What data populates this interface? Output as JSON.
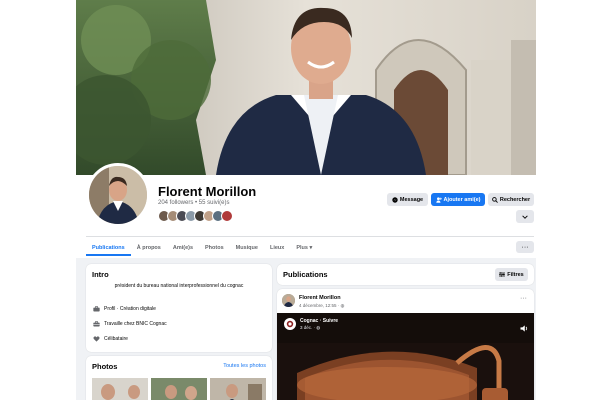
{
  "profile": {
    "name": "Florent Morillon",
    "stats": "204 followers • 55 suivi(e)s",
    "friend_colors": [
      "#6d5a4c",
      "#a58c77",
      "#4b4b54",
      "#8b9aa8",
      "#3f3a35",
      "#c0a088",
      "#5b6f80",
      "#b03a3a"
    ]
  },
  "actions": {
    "message": "Message",
    "add_friend": "Ajouter ami(e)",
    "search": "Rechercher"
  },
  "tabs": [
    {
      "label": "Publications",
      "active": true
    },
    {
      "label": "À propos",
      "active": false
    },
    {
      "label": "Ami(e)s",
      "active": false
    },
    {
      "label": "Photos",
      "active": false
    },
    {
      "label": "Musique",
      "active": false
    },
    {
      "label": "Lieux",
      "active": false
    },
    {
      "label": "Plus ▾",
      "active": false
    }
  ],
  "intro": {
    "title": "Intro",
    "bio": "président du bureau national interprofessionnel du cognac",
    "items": [
      {
        "icon": "briefcase-icon",
        "label": "Profil · Création digitale"
      },
      {
        "icon": "work-icon",
        "label": "Travaille chez BNIC Cognac"
      },
      {
        "icon": "heart-icon",
        "label": "Célibataire"
      }
    ]
  },
  "photos": {
    "title": "Photos",
    "link": "Toutes les photos"
  },
  "publications": {
    "title": "Publications",
    "filters_label": "Filtres"
  },
  "post": {
    "author": "Florent Morillon",
    "date": "4 décembre, 12:55 · ◍",
    "video_title": "Cognac · Suivre",
    "video_sub": "3 déc. · ◍"
  },
  "colors": {
    "accent": "#1877f2",
    "secondary_button": "#e4e6eb",
    "background": "#f0f2f5"
  }
}
